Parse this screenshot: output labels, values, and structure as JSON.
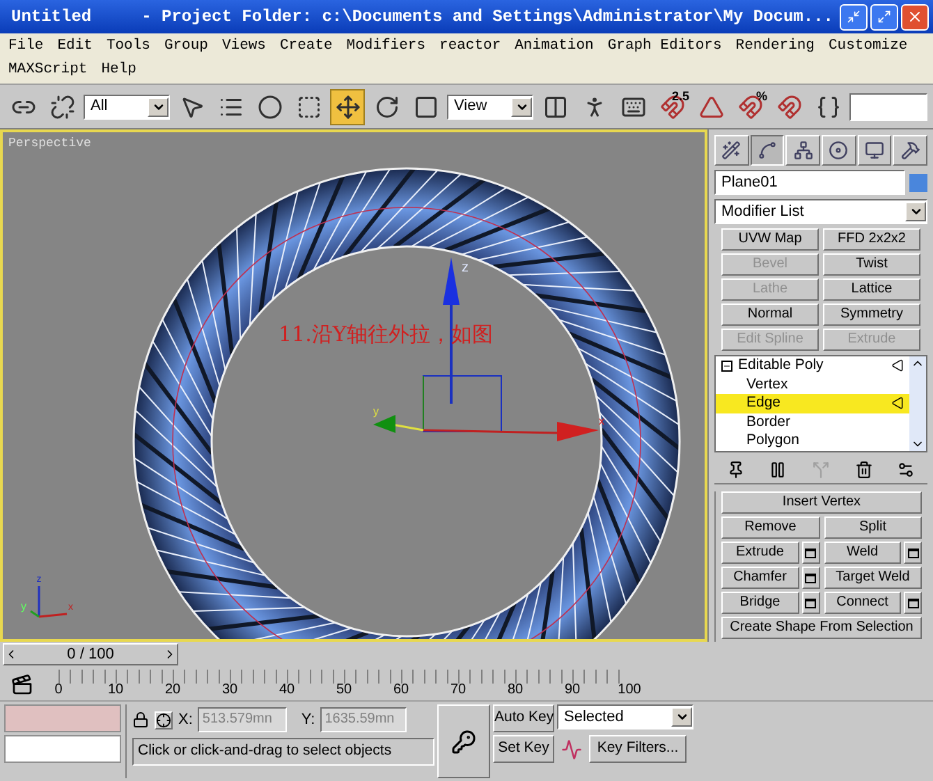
{
  "window": {
    "title": "Untitled",
    "subtitle": "- Project Folder: c:\\Documents and Settings\\Administrator\\My Docum..."
  },
  "menu": [
    "File",
    "Edit",
    "Tools",
    "Group",
    "Views",
    "Create",
    "Modifiers",
    "reactor",
    "Animation",
    "Graph Editors",
    "Rendering",
    "Customize",
    "MAXScript",
    "Help"
  ],
  "toolbar": [
    {
      "kind": "link",
      "selected": false
    },
    {
      "kind": "unlink",
      "selected": false
    },
    {
      "kind": "dropdown",
      "value": "All"
    },
    {
      "kind": "select",
      "selected": false
    },
    {
      "kind": "select-by-name",
      "selected": false
    },
    {
      "kind": "region",
      "selected": false
    },
    {
      "kind": "window",
      "selected": false
    },
    {
      "kind": "move",
      "selected": true
    },
    {
      "kind": "rotate",
      "selected": false
    },
    {
      "kind": "scale",
      "selected": false
    },
    {
      "kind": "dropdown",
      "value": "View"
    },
    {
      "kind": "pivot",
      "selected": false
    },
    {
      "kind": "manipulate",
      "selected": false
    },
    {
      "kind": "keyboard",
      "selected": false
    },
    {
      "kind": "snap",
      "selected": false,
      "label": "2.5"
    },
    {
      "kind": "angle-snap",
      "selected": false
    },
    {
      "kind": "percent-snap",
      "selected": false,
      "label": "%"
    },
    {
      "kind": "spinner-snap",
      "selected": false
    },
    {
      "kind": "named-selection",
      "selected": false
    }
  ],
  "viewport": {
    "label": "Perspective",
    "annotation": "11.沿Y轴往外拉，如图",
    "gizmo_labels": [
      "z",
      "y",
      "x"
    ],
    "tripod_labels": [
      "z",
      "y",
      "x"
    ]
  },
  "command_panel": {
    "tabs": [
      {
        "kind": "create",
        "selected": false
      },
      {
        "kind": "modify",
        "selected": true
      },
      {
        "kind": "hierarchy",
        "selected": false
      },
      {
        "kind": "motion",
        "selected": false
      },
      {
        "kind": "display",
        "selected": false
      },
      {
        "kind": "utilities",
        "selected": false
      }
    ],
    "object_name": "Plane01",
    "modifier_list": "Modifier List",
    "modifier_buttons": [
      {
        "label": "UVW Map",
        "disabled": false
      },
      {
        "label": "FFD 2x2x2",
        "disabled": false
      },
      {
        "label": "Bevel",
        "disabled": true
      },
      {
        "label": "Twist",
        "disabled": false
      },
      {
        "label": "Lathe",
        "disabled": true
      },
      {
        "label": "Lattice",
        "disabled": false
      },
      {
        "label": "Normal",
        "disabled": false
      },
      {
        "label": "Symmetry",
        "disabled": false
      },
      {
        "label": "Edit Spline",
        "disabled": true
      },
      {
        "label": "Extrude",
        "disabled": true
      }
    ],
    "stack": [
      {
        "label": "Editable Poly",
        "expanded": true,
        "selected": false,
        "children": [
          {
            "label": "Vertex",
            "selected": false
          },
          {
            "label": "Edge",
            "selected": true
          },
          {
            "label": "Border",
            "selected": false
          },
          {
            "label": "Polygon",
            "selected": false
          }
        ]
      }
    ],
    "rollout": [
      {
        "label": "Insert Vertex",
        "kind": "wide",
        "settings": false
      },
      {
        "label": "Remove",
        "kind": "half",
        "settings": false
      },
      {
        "label": "Split",
        "kind": "half",
        "settings": false
      },
      {
        "label": "Extrude",
        "kind": "half",
        "settings": true
      },
      {
        "label": "Weld",
        "kind": "half",
        "settings": true
      },
      {
        "label": "Chamfer",
        "kind": "half",
        "settings": true
      },
      {
        "label": "Target Weld",
        "kind": "half",
        "settings": false
      },
      {
        "label": "Bridge",
        "kind": "half",
        "settings": true
      },
      {
        "label": "Connect",
        "kind": "half",
        "settings": true
      },
      {
        "label": "Create Shape From Selection",
        "kind": "wide",
        "settings": false
      }
    ]
  },
  "timeline": {
    "slider": {
      "label": "0 / 100",
      "level": 0
    },
    "ticks": [
      "0",
      "10",
      "20",
      "30",
      "40",
      "50",
      "60",
      "70",
      "80",
      "90",
      "100"
    ]
  },
  "status": {
    "x_label": "X:",
    "x": "513.579mn",
    "y_label": "Y:",
    "y": "1635.59mn",
    "auto_key": "Auto Key",
    "key_mode": "Selected",
    "set_key": "Set Key",
    "key_filters": "Key Filters...",
    "prompt": "Click or click-and-drag to select objects"
  }
}
